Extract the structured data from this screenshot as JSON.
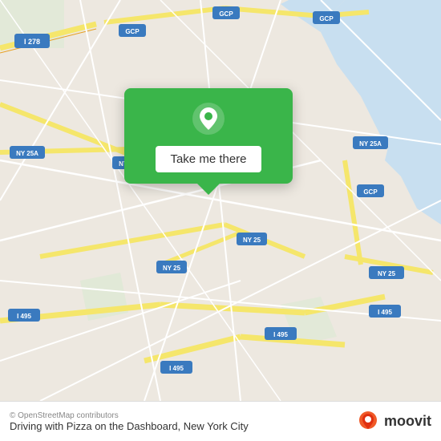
{
  "map": {
    "background_color": "#e8e0d8",
    "water_color": "#c8dff0",
    "road_color_major": "#f5e66b",
    "road_color_minor": "#ffffff",
    "road_color_highway": "#f5e66b"
  },
  "popup": {
    "background_color": "#3ab54a",
    "button_label": "Take me there",
    "pin_color": "white"
  },
  "bottom_bar": {
    "copyright": "© OpenStreetMap contributors",
    "title": "Driving with Pizza on the Dashboard, New York City",
    "moovit_label": "moovit"
  }
}
